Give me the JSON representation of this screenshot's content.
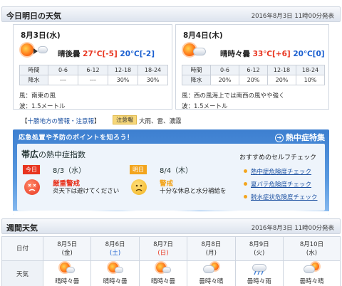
{
  "today_header": {
    "title": "今日明日の天気",
    "issued": "2016年8月3日 11時00分発表"
  },
  "days": [
    {
      "date": "8月3日(水)",
      "weather": "晴後曇",
      "high": "27℃",
      "high_diff": "[-5]",
      "low": "20℃",
      "low_diff": "[-2]",
      "icon": "sunny-then-cloudy-icon",
      "rain_header": [
        "時間",
        "0-6",
        "6-12",
        "12-18",
        "18-24"
      ],
      "rain_row": [
        "降水",
        "---",
        "---",
        "30%",
        "30%"
      ],
      "wind": "風：南東の風",
      "wave": "波：1.5メートル"
    },
    {
      "date": "8月4日(木)",
      "weather": "晴時々曇",
      "high": "33℃",
      "high_diff": "[+6]",
      "low": "20℃",
      "low_diff": "[0]",
      "icon": "sunny-sometimes-cloudy-icon",
      "rain_header": [
        "時間",
        "0-6",
        "6-12",
        "12-18",
        "18-24"
      ],
      "rain_row": [
        "降水",
        "20%",
        "20%",
        "20%",
        "10%"
      ],
      "wind": "風：西の風海上では南西の風やや強く",
      "wave": "波：1.5メートル"
    }
  ],
  "alerts": {
    "bracket_open": "【",
    "link": "十勝地方の警報・注意報",
    "bracket_close": "】",
    "badge": "注意報",
    "items": "大雨、雷、濃霧"
  },
  "heatstroke": {
    "banner": "応急処置や予防のポイントを知ろう！",
    "special": "熱中症特集",
    "place": "帯広",
    "index_label": "の熱中症指数",
    "days": [
      {
        "tag": "今日",
        "date": "8/3",
        "dow": "（水）",
        "level": "厳重警戒",
        "note": "炎天下は避けてください",
        "tag_color": "#e8341f",
        "level_color": "#e8341f"
      },
      {
        "tag": "明日",
        "date": "8/4",
        "dow": "（木）",
        "level": "警戒",
        "note": "十分な休息と水分補給を",
        "tag_color": "#f3a51e",
        "level_color": "#f3a51e"
      }
    ],
    "self_check": {
      "title": "おすすめのセルフチェック",
      "items": [
        "熱中症危険度チェック",
        "夏バテ危険度チェック",
        "脱水症状危険度チェック"
      ]
    }
  },
  "weekly": {
    "title": "週間天気",
    "issued": "2016年8月3日 11時00分発表",
    "date_label": "日付",
    "weather_label": "天気",
    "days": [
      {
        "date": "8月5日",
        "dow": "(金)",
        "weather": "晴時々曇",
        "icon": "sunny-cloudy-icon"
      },
      {
        "date": "8月6日",
        "dow": "(土)",
        "weather": "晴時々曇",
        "icon": "sunny-cloudy-icon"
      },
      {
        "date": "8月7日",
        "dow": "(日)",
        "weather": "晴時々曇",
        "icon": "sunny-cloudy-icon"
      },
      {
        "date": "8月8日",
        "dow": "(月)",
        "weather": "曇時々晴",
        "icon": "cloudy-sunny-icon"
      },
      {
        "date": "8月9日",
        "dow": "(火)",
        "weather": "曇時々雨",
        "icon": "cloudy-rain-icon"
      },
      {
        "date": "8月10日",
        "dow": "(水)",
        "weather": "曇時々晴",
        "icon": "cloudy-sunny-icon"
      }
    ]
  }
}
